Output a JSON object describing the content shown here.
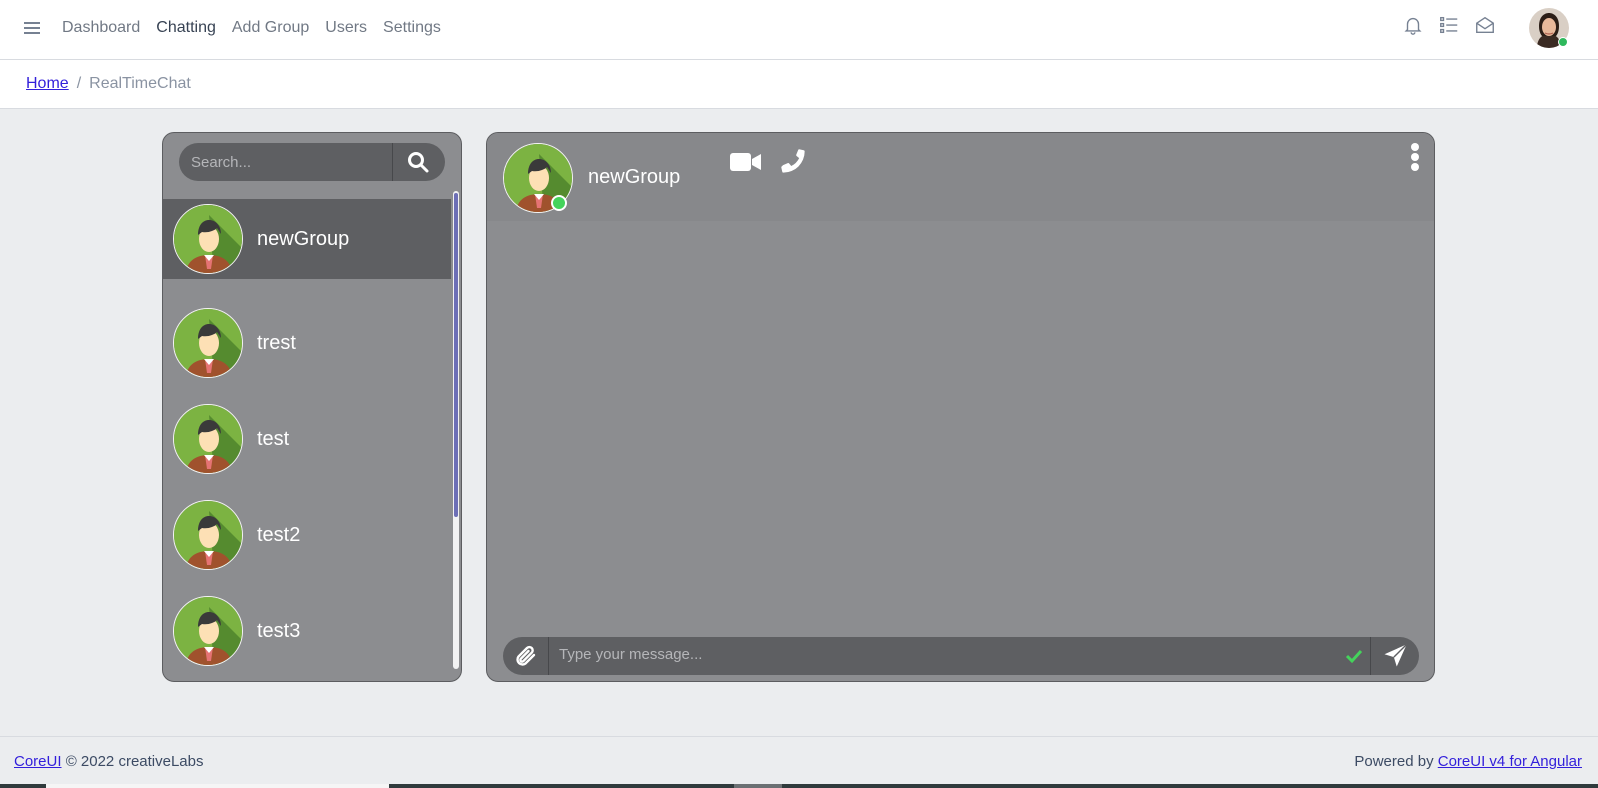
{
  "nav": {
    "items": [
      "Dashboard",
      "Chatting",
      "Add Group",
      "Users",
      "Settings"
    ],
    "active": "Chatting"
  },
  "header_icons": [
    "bell-icon",
    "list-icon",
    "envelope-open-icon"
  ],
  "breadcrumb": {
    "home": "Home",
    "separator": "/",
    "current": "RealTimeChat"
  },
  "search": {
    "placeholder": "Search...",
    "value": ""
  },
  "contacts": [
    {
      "name": "newGroup",
      "active": true
    },
    {
      "name": "trest",
      "active": false
    },
    {
      "name": "test",
      "active": false
    },
    {
      "name": "test2",
      "active": false
    },
    {
      "name": "test3",
      "active": false
    }
  ],
  "chat": {
    "name": "newGroup",
    "online": true,
    "composer_placeholder": "Type your message...",
    "composer_value": ""
  },
  "footer": {
    "brand": "CoreUI",
    "copyright": "© 2022 creativeLabs",
    "powered_prefix": "Powered by",
    "powered_link": "CoreUI v4 for Angular"
  },
  "colors": {
    "panel": "#8c8d90",
    "panel_dark": "#5e5f62",
    "online": "#44d35b",
    "link": "#321fdb"
  }
}
